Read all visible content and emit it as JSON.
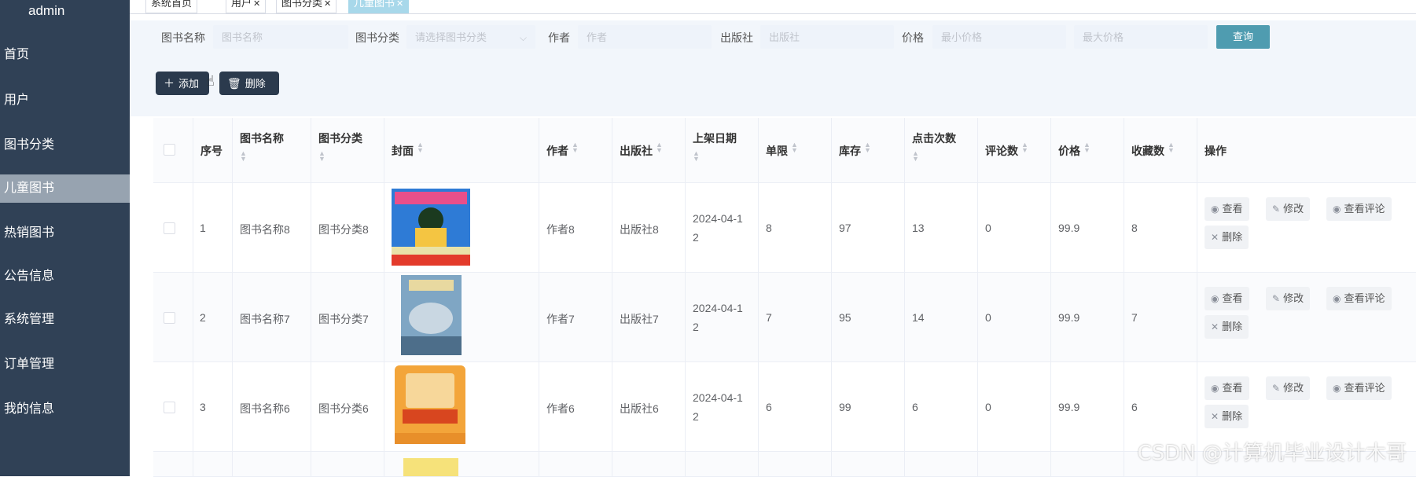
{
  "sidebar": {
    "user": "admin",
    "items": [
      {
        "label": "首页"
      },
      {
        "label": "用户"
      },
      {
        "label": "图书分类"
      },
      {
        "label": "儿童图书"
      },
      {
        "label": "热销图书"
      },
      {
        "label": "公告信息"
      },
      {
        "label": "系统管理"
      },
      {
        "label": "订单管理"
      },
      {
        "label": "我的信息"
      }
    ],
    "active_index": 3
  },
  "tags": [
    {
      "label": "系统首页",
      "closable": false
    },
    {
      "label": "用户",
      "closable": true
    },
    {
      "label": "图书分类",
      "closable": true
    },
    {
      "label": "儿童图书",
      "closable": true
    }
  ],
  "search": {
    "name_label": "图书名称",
    "name_placeholder": "图书名称",
    "category_label": "图书分类",
    "category_placeholder": "请选择图书分类",
    "author_label": "作者",
    "author_placeholder": "作者",
    "publisher_label": "出版社",
    "publisher_placeholder": "出版社",
    "price_label": "价格",
    "min_price_placeholder": "最小价格",
    "max_price_placeholder": "最大价格",
    "query_button": "查询"
  },
  "actions": {
    "add": "添加",
    "delete": "删除"
  },
  "table": {
    "headers": {
      "index": "序号",
      "name": "图书名称",
      "category": "图书分类",
      "cover": "封面",
      "author": "作者",
      "publisher": "出版社",
      "date": "上架日期",
      "limit": "单限",
      "stock": "库存",
      "clicks": "点击次数",
      "comments": "评论数",
      "price": "价格",
      "favorites": "收藏数",
      "ops": "操作"
    },
    "rows": [
      {
        "index": "1",
        "name": "图书名称8",
        "category": "图书分类8",
        "author": "作者8",
        "publisher": "出版社8",
        "date_line1": "2024-04-1",
        "date_line2": "2",
        "limit": "8",
        "stock": "97",
        "clicks": "13",
        "comments": "0",
        "price": "99.9",
        "favorites": "8"
      },
      {
        "index": "2",
        "name": "图书名称7",
        "category": "图书分类7",
        "author": "作者7",
        "publisher": "出版社7",
        "date_line1": "2024-04-1",
        "date_line2": "2",
        "limit": "7",
        "stock": "95",
        "clicks": "14",
        "comments": "0",
        "price": "99.9",
        "favorites": "7"
      },
      {
        "index": "3",
        "name": "图书名称6",
        "category": "图书分类6",
        "author": "作者6",
        "publisher": "出版社6",
        "date_line1": "2024-04-1",
        "date_line2": "2",
        "limit": "6",
        "stock": "99",
        "clicks": "6",
        "comments": "0",
        "price": "99.9",
        "favorites": "6"
      }
    ],
    "row_ops": {
      "view": "查看",
      "edit": "修改",
      "view_comments": "查看评论",
      "delete": "删除"
    }
  },
  "watermark": "CSDN @计算机毕业设计木哥",
  "colors": {
    "sidebar": "#304156",
    "active_nav": "#97a3b0",
    "query_button": "#4f9cb0",
    "dark_button": "#2b3a4d",
    "active_tag": "#a8d8ea"
  }
}
